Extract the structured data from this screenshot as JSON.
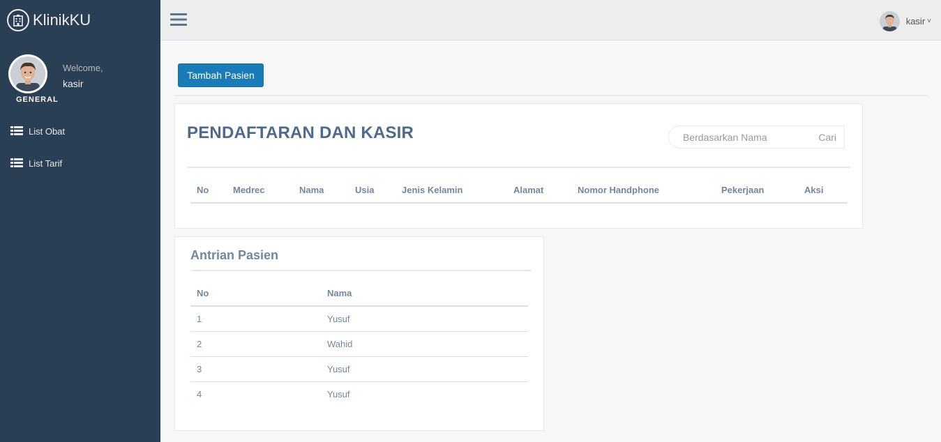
{
  "brand": {
    "name": "KlinikKU",
    "icon": "hospital-icon"
  },
  "profile": {
    "welcome": "Welcome,",
    "username": "kasir",
    "section": "GENERAL"
  },
  "sidebar": {
    "items": [
      {
        "label": "List Obat",
        "icon": "list-icon"
      },
      {
        "label": "List Tarif",
        "icon": "list-icon"
      }
    ]
  },
  "topnav": {
    "user": "kasir",
    "caret": "˅"
  },
  "main": {
    "add_button": "Tambah Pasien",
    "registration": {
      "title": "PENDAFTARAN DAN KASIR",
      "search_placeholder": "Berdasarkan Nama",
      "search_button": "Cari",
      "columns": [
        "No",
        "Medrec",
        "Nama",
        "Usia",
        "Jenis Kelamin",
        "Alamat",
        "Nomor Handphone",
        "Pekerjaan",
        "Aksi"
      ]
    },
    "queue": {
      "title": "Antrian Pasien",
      "columns": [
        "No",
        "Nama"
      ],
      "rows": [
        {
          "no": "1",
          "nama": "Yusuf"
        },
        {
          "no": "2",
          "nama": "Wahid"
        },
        {
          "no": "3",
          "nama": "Yusuf"
        },
        {
          "no": "4",
          "nama": "Yusuf"
        }
      ]
    }
  },
  "colors": {
    "sidebar": "#2a3f54",
    "primary_button": "#1a7bb9",
    "title": "#4d6a8c"
  }
}
